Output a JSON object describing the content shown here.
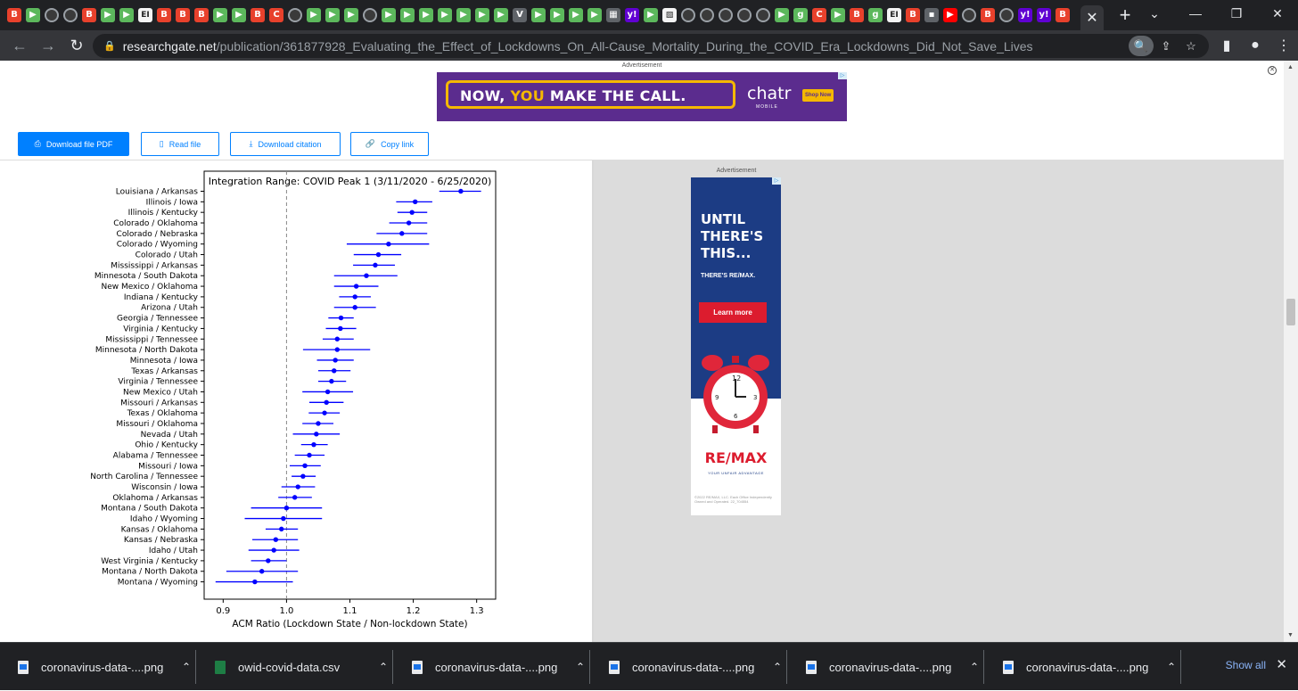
{
  "browser": {
    "tab_favicons": [
      "BI",
      "play",
      "globe",
      "globe",
      "BI",
      "play",
      "play",
      "EI",
      "BI",
      "BI",
      "BI",
      "play",
      "play",
      "BI",
      "red",
      "globe",
      "play",
      "play",
      "play",
      "globe",
      "play",
      "play",
      "play",
      "play",
      "play",
      "play",
      "play",
      "V",
      "play",
      "play",
      "play",
      "play",
      "grid",
      "y!",
      "play",
      "img",
      "globe",
      "globe",
      "globe",
      "globe",
      "globe",
      "play",
      "g",
      "red",
      "play",
      "BI",
      "g",
      "EI",
      "BI",
      "grey",
      "yt",
      "globe",
      "BI",
      "globe",
      "y!",
      "y!",
      "BI"
    ],
    "active_tab_close": "✕",
    "new_tab": "+",
    "window_controls": {
      "minimize": "⌄",
      "restore": "—",
      "maximize": "❐",
      "close": "✕"
    },
    "url_domain": "researchgate.net",
    "url_path": "/publication/361877928_Evaluating_the_Effect_of_Lockdowns_On_All-Cause_Mortality_During_the_COVID_Era_Lockdowns_Did_Not_Save_Lives"
  },
  "top_ad": {
    "label": "Advertisement",
    "headline_1": "NOW, ",
    "headline_you": "YOU",
    "headline_2": " MAKE THE CALL.",
    "brand": "chatr",
    "brand_sub": "MOBILE",
    "cta": "Shop Now"
  },
  "actions": {
    "download_pdf": "Download file PDF",
    "read_file": "Read file",
    "download_citation": "Download citation",
    "copy_link": "Copy link"
  },
  "side_ad": {
    "label": "Advertisement",
    "headline": "UNTIL THERE'S THIS...",
    "sub": "THERE'S RE/MAX.",
    "cta": "Learn more",
    "brand": "RE/MAX",
    "tagline": "YOUR UNFAIR ADVANTAGE",
    "fine_print": "©2022 RE/MAX, LLC. Each Office Independently Owned and Operated. 22_704554"
  },
  "chart_data": {
    "type": "scatter",
    "title": "Integration Range: COVID Peak 1 (3/11/2020 - 6/25/2020)",
    "xlabel": "ACM Ratio (Lockdown State / Non-lockdown State)",
    "ylabel": "",
    "xlim": [
      0.87,
      1.33
    ],
    "xticks": [
      "0.9",
      "1.0",
      "1.1",
      "1.2",
      "1.3"
    ],
    "reference_line": 1.0,
    "point_color": "#0000ff",
    "categories": [
      "Louisiana / Arkansas",
      "Illinois / Iowa",
      "Illinois / Kentucky",
      "Colorado / Oklahoma",
      "Colorado / Nebraska",
      "Colorado / Wyoming",
      "Colorado / Utah",
      "Mississippi / Arkansas",
      "Minnesota / South Dakota",
      "New Mexico / Oklahoma",
      "Indiana / Kentucky",
      "Arizona / Utah",
      "Georgia / Tennessee",
      "Virginia / Kentucky",
      "Mississippi / Tennessee",
      "Minnesota / North Dakota",
      "Minnesota / Iowa",
      "Texas / Arkansas",
      "Virginia / Tennessee",
      "New Mexico / Utah",
      "Missouri / Arkansas",
      "Texas / Oklahoma",
      "Missouri / Oklahoma",
      "Nevada / Utah",
      "Ohio / Kentucky",
      "Alabama / Tennessee",
      "Missouri / Iowa",
      "North Carolina / Tennessee",
      "Wisconsin / Iowa",
      "Oklahoma / Arkansas",
      "Montana / South Dakota",
      "Idaho / Wyoming",
      "Kansas / Oklahoma",
      "Kansas / Nebraska",
      "Idaho / Utah",
      "West Virginia / Kentucky",
      "Montana / North Dakota",
      "Montana / Wyoming"
    ],
    "estimate": [
      1.275,
      1.203,
      1.198,
      1.193,
      1.182,
      1.161,
      1.145,
      1.14,
      1.126,
      1.11,
      1.108,
      1.108,
      1.086,
      1.085,
      1.08,
      1.08,
      1.077,
      1.075,
      1.071,
      1.065,
      1.063,
      1.06,
      1.05,
      1.047,
      1.043,
      1.036,
      1.029,
      1.026,
      1.018,
      1.013,
      1.0,
      0.995,
      0.992,
      0.983,
      0.98,
      0.971,
      0.961,
      0.95
    ],
    "lower": [
      1.241,
      1.173,
      1.175,
      1.162,
      1.142,
      1.095,
      1.106,
      1.105,
      1.075,
      1.075,
      1.083,
      1.075,
      1.066,
      1.062,
      1.057,
      1.026,
      1.048,
      1.05,
      1.05,
      1.025,
      1.036,
      1.035,
      1.025,
      1.01,
      1.023,
      1.013,
      1.005,
      1.008,
      0.992,
      0.987,
      0.944,
      0.934,
      0.967,
      0.946,
      0.94,
      0.944,
      0.905,
      0.888
    ],
    "upper": [
      1.307,
      1.23,
      1.222,
      1.222,
      1.222,
      1.225,
      1.181,
      1.171,
      1.175,
      1.145,
      1.133,
      1.141,
      1.106,
      1.11,
      1.106,
      1.132,
      1.106,
      1.101,
      1.094,
      1.105,
      1.09,
      1.084,
      1.074,
      1.084,
      1.065,
      1.06,
      1.054,
      1.046,
      1.045,
      1.04,
      1.056,
      1.056,
      1.018,
      1.018,
      1.02,
      1.0,
      1.018,
      1.01
    ]
  },
  "downloads": {
    "items": [
      {
        "name": "coronavirus-data-....png",
        "kind": "img"
      },
      {
        "name": "owid-covid-data.csv",
        "kind": "csv"
      },
      {
        "name": "coronavirus-data-....png",
        "kind": "img"
      },
      {
        "name": "coronavirus-data-....png",
        "kind": "img"
      },
      {
        "name": "coronavirus-data-....png",
        "kind": "img"
      },
      {
        "name": "coronavirus-data-....png",
        "kind": "img"
      }
    ],
    "show_all": "Show all"
  }
}
